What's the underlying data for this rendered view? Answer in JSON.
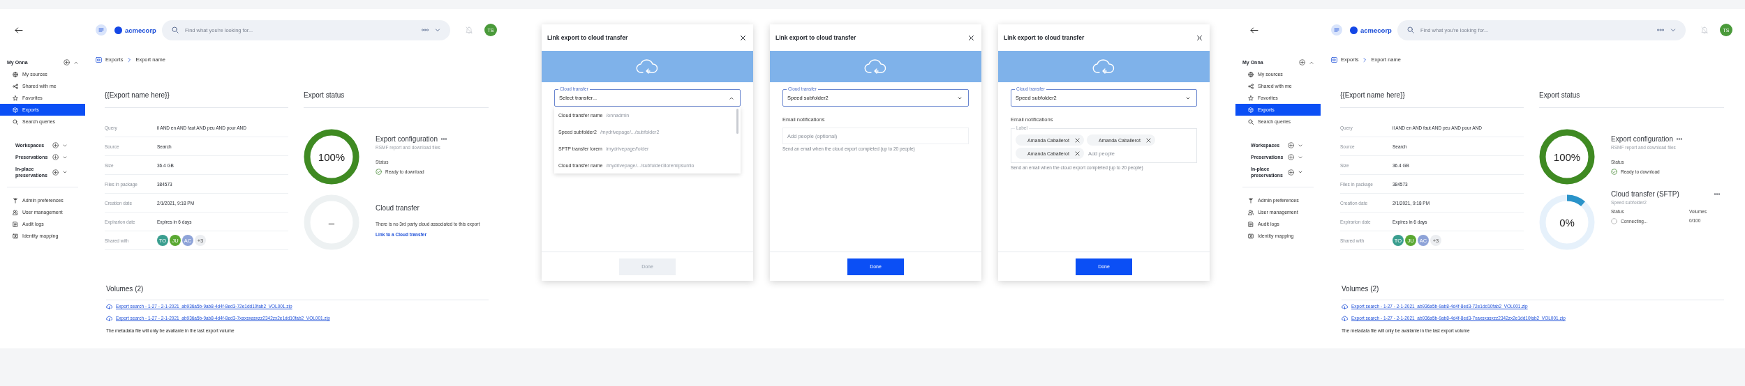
{
  "screens": [
    {
      "topbar": {
        "brand": "acmecorp",
        "search_placeholder": "Find what you're looking for...",
        "avatar": "TS"
      },
      "sidebar": {
        "sections": [
          {
            "label": "My Onna",
            "expanded": true,
            "items": [
              {
                "label": "My sources",
                "selected": false
              },
              {
                "label": "Shared with me",
                "selected": false
              },
              {
                "label": "Favorites",
                "selected": false
              },
              {
                "label": "Exports",
                "selected": true
              },
              {
                "label": "Search queries",
                "selected": false
              }
            ]
          },
          {
            "label": "Workspaces",
            "expanded": false
          },
          {
            "label": "Preservations",
            "expanded": false
          },
          {
            "label": "In-place preservations",
            "expanded": false
          }
        ],
        "admin_items": [
          "Admin preferences",
          "User management",
          "Audit logs",
          "Identity mapping"
        ]
      },
      "breadcrumb": [
        "Exports",
        "Export name"
      ],
      "details": {
        "title": "{{Export name here}}",
        "rows": [
          {
            "label": "Query",
            "value": "il AND en AND faut AND peu AND pour AND"
          },
          {
            "label": "Source",
            "value": "Search"
          },
          {
            "label": "Size",
            "value": "36.4 GB"
          },
          {
            "label": "Files in package",
            "value": "384573"
          },
          {
            "label": "Creation date",
            "value": "2/1/2021, 9:18 PM"
          },
          {
            "label": "Expirarion date",
            "value": "Expires in 6 days"
          }
        ],
        "shared_with": {
          "label": "Shared with",
          "avatars": [
            {
              "initials": "TO",
              "color": "#3a9e8f"
            },
            {
              "initials": "JU",
              "color": "#5aa832"
            },
            {
              "initials": "AC",
              "color": "#8ea3d8"
            }
          ],
          "more": "+3"
        }
      },
      "status": {
        "title": "Export status",
        "export_configuration": {
          "percent": "100%",
          "level": 1,
          "title": "Export configuration",
          "subtitle": "RSMF report and download files",
          "status_label": "Status",
          "status": "Ready to download"
        },
        "cloud_transfer": {
          "kind": "empty",
          "value": "–",
          "title": "Cloud transfer",
          "message": "There is no 3rd party cloud associated to this export",
          "link": "Link to a Cloud transfer"
        }
      },
      "volumes": {
        "title": "Volumes (2)",
        "files": [
          "Export search - 1-27 - 2-1-2021_ab936a5b-9ab8-4d4f-8ed3-72e1dd10fab2_VOL001.zip",
          "Export search - 1-27 - 2-1-2021_ab936a5b-9ab8-4d4f-8ed3-7xaxsxasxzz2342zx2e1dd10fab2_VOL001.zip"
        ],
        "note": "The metadata file will only be availanle in the last export volume"
      }
    },
    {
      "topbar": {
        "brand": "acmecorp",
        "search_placeholder": "Find what you're looking for...",
        "avatar": "TS"
      },
      "sidebar": {
        "sections": [
          {
            "label": "My Onna",
            "expanded": true,
            "items": [
              {
                "label": "My sources",
                "selected": false
              },
              {
                "label": "Shared with me",
                "selected": false
              },
              {
                "label": "Favorites",
                "selected": false
              },
              {
                "label": "Exports",
                "selected": true
              },
              {
                "label": "Search queries",
                "selected": false
              }
            ]
          },
          {
            "label": "Workspaces",
            "expanded": false
          },
          {
            "label": "Preservations",
            "expanded": false
          },
          {
            "label": "In-place preservations",
            "expanded": false
          }
        ],
        "admin_items": [
          "Admin preferences",
          "User management",
          "Audit logs",
          "Identity mapping"
        ]
      },
      "breadcrumb": [
        "Exports",
        "Export name"
      ],
      "details": {
        "title": "{{Export name here}}",
        "rows": [
          {
            "label": "Query",
            "value": "il AND en AND faut AND peu AND pour AND"
          },
          {
            "label": "Source",
            "value": "Search"
          },
          {
            "label": "Size",
            "value": "36.4 GB"
          },
          {
            "label": "Files in package",
            "value": "384573"
          },
          {
            "label": "Creation date",
            "value": "2/1/2021, 9:18 PM"
          },
          {
            "label": "Expirarion date",
            "value": "Expires in 6 days"
          }
        ],
        "shared_with": {
          "label": "Shared with",
          "avatars": [
            {
              "initials": "TO",
              "color": "#3a9e8f"
            },
            {
              "initials": "JU",
              "color": "#5aa832"
            },
            {
              "initials": "AC",
              "color": "#8ea3d8"
            }
          ],
          "more": "+3"
        }
      },
      "status": {
        "title": "Export status",
        "export_configuration": {
          "percent": "100%",
          "level": 1,
          "title": "Export configuration",
          "subtitle": "RSMF report and download files",
          "status_label": "Status",
          "status": "Ready to download"
        },
        "cloud_transfer": {
          "kind": "connecting",
          "value": "0%",
          "title": "Cloud transfer (SFTP)",
          "subtitle": "Speed subfolder2",
          "status_label": "Status",
          "status": "Connecting...",
          "volumes_label": "Volumes",
          "volumes": "0/100"
        }
      },
      "volumes": {
        "title": "Volumes (2)",
        "files": [
          "Export search - 1-27 - 2-1-2021_ab936a5b-9ab8-4d4f-8ed3-72e1dd10fab2_VOL001.zip",
          "Export search - 1-27 - 2-1-2021_ab936a5b-9ab8-4d4f-8ed3-7xaxsxasxzz2342zx2e1dd10fab2_VOL001.zip"
        ],
        "note": "The metadata file will only be availanle in the last export volume"
      }
    }
  ],
  "dialogs": [
    {
      "title": "Link export to cloud transfer",
      "field_label": "Cloud transfer",
      "field_value": "Select transfer...",
      "expanded": true,
      "options": [
        {
          "name": "Cloud transfer name",
          "path": "/onnadmin"
        },
        {
          "name": "Speed subfolder2",
          "path": "/mydrivepage/.../subfolder2"
        },
        {
          "name": "SFTP transfer lorem",
          "path": "/mydrivepage/folder"
        },
        {
          "name": "Cloud transfer name",
          "path": "/mydrivepage/.../subfolder3loremipsumlo"
        }
      ],
      "done": {
        "label": "Done",
        "disabled": true
      }
    },
    {
      "title": "Link export to cloud transfer",
      "field_label": "Cloud transfer",
      "field_value": "Speed subfolder2",
      "expanded": false,
      "email": {
        "kind": "input",
        "label": "Email notifications",
        "placeholder": "Add people (optional)",
        "help": "Send an email when the cloud export completed (up to 20 people)"
      },
      "done": {
        "label": "Done",
        "disabled": false
      }
    },
    {
      "title": "Link export to cloud transfer",
      "field_label": "Cloud transfer",
      "field_value": "Speed subfolder2",
      "expanded": false,
      "email": {
        "kind": "chips",
        "label": "Email notifications",
        "field_label": "Label",
        "chips": [
          "Amanda Caballerot",
          "Amanda Caballerot",
          "Amanda Caballerot"
        ],
        "placeholder": "Add people",
        "help": "Send an email when the cloud export completed (up to 20 people)"
      },
      "done": {
        "label": "Done",
        "disabled": false
      }
    }
  ]
}
